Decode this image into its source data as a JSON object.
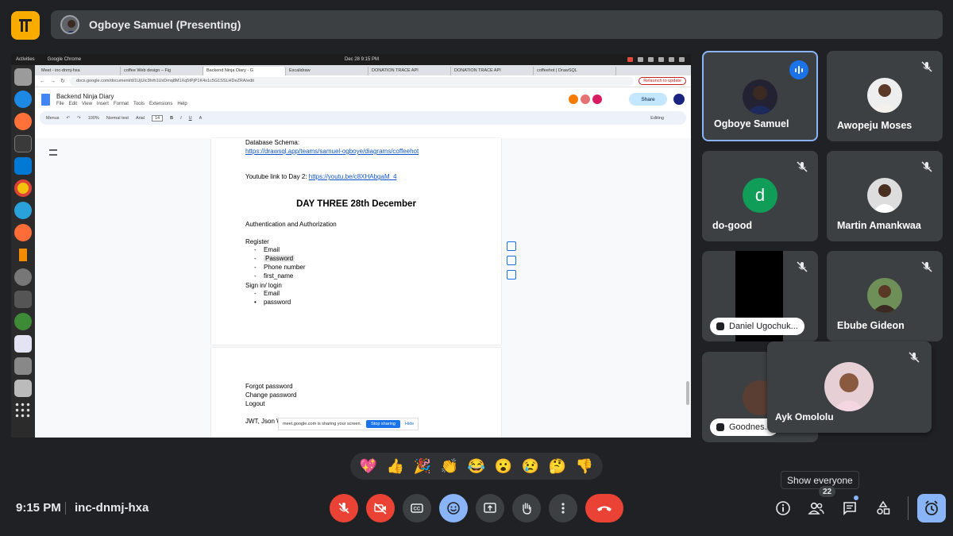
{
  "presenter": {
    "label": "Ogboye Samuel (Presenting)"
  },
  "screen": {
    "os": {
      "activities": "Activities",
      "app": "Google Chrome",
      "clock": "Dec 28  9:15 PM"
    },
    "tabs": [
      {
        "label": "Meet - inc-dnmj-hxa"
      },
      {
        "label": "coffee Web design – Fig"
      },
      {
        "label": "Backend Ninja Diary - G"
      },
      {
        "label": "Excalidraw"
      },
      {
        "label": "DONATION TRACE API"
      },
      {
        "label": "DONATION TRACE API"
      },
      {
        "label": "coffeehot | DrawSQL"
      }
    ],
    "url": "docs.google.com/document/d/1UjUlc3hrh1UxDmq8M1Xq5tPjP1K4s1c5G1SSLHDeZRA/edit",
    "relaunch": "Relaunch to update",
    "doc": {
      "title": "Backend Ninja Diary",
      "menu": [
        "File",
        "Edit",
        "View",
        "Insert",
        "Format",
        "Tools",
        "Extensions",
        "Help"
      ],
      "share": "Share",
      "toolbar": {
        "menus": "Menus",
        "zoom": "100%",
        "style": "Normal text",
        "font": "Arial",
        "size": "14",
        "mode": "Editing"
      },
      "schema_label": "Database Schema:",
      "schema_link": "https://drawsql.app/teams/samuel-ogboye/diagrams/coffeehot",
      "youtube_label": "Youtube link to Day 2:",
      "youtube_link": "https://youtu.be/c8XHAbgaM_4",
      "heading": "DAY THREE 28th December",
      "subheading": "Authentication and Authorization",
      "register": "Register",
      "register_items": [
        "Email",
        "Password",
        "Phone number",
        "first_name"
      ],
      "signin": "Sign in/ login",
      "signin_items": [
        "Email",
        "password"
      ],
      "page2": [
        "Forgot password",
        "Change password",
        "Logout"
      ],
      "jwt": "JWT, Json Web Token"
    },
    "notice": {
      "text": "meet.google.com is sharing your screen.",
      "stop": "Stop sharing",
      "hide": "Hide"
    }
  },
  "participants": [
    {
      "name": "Ogboye Samuel"
    },
    {
      "name": "Awopeju Moses"
    },
    {
      "name": "do-good",
      "initial": "d"
    },
    {
      "name": "Martin Amankwaa"
    },
    {
      "name": "Daniel Ugochuk..."
    },
    {
      "name": "Ebube Gideon"
    },
    {
      "name": "Goodnes..."
    },
    {
      "name": "Ayk Omololu"
    }
  ],
  "reactions": [
    "💖",
    "👍",
    "🎉",
    "👏",
    "😂",
    "😮",
    "😢",
    "🤔",
    "👎"
  ],
  "meeting": {
    "time": "9:15 PM",
    "code": "inc-dnmj-hxa"
  },
  "people": {
    "tooltip": "Show everyone",
    "count": "22"
  },
  "colors": {
    "background": "#202124",
    "surface": "#3c4043",
    "hangup": "#ea4335",
    "accent": "#8ab4f8",
    "logo": "#f9ab00"
  }
}
